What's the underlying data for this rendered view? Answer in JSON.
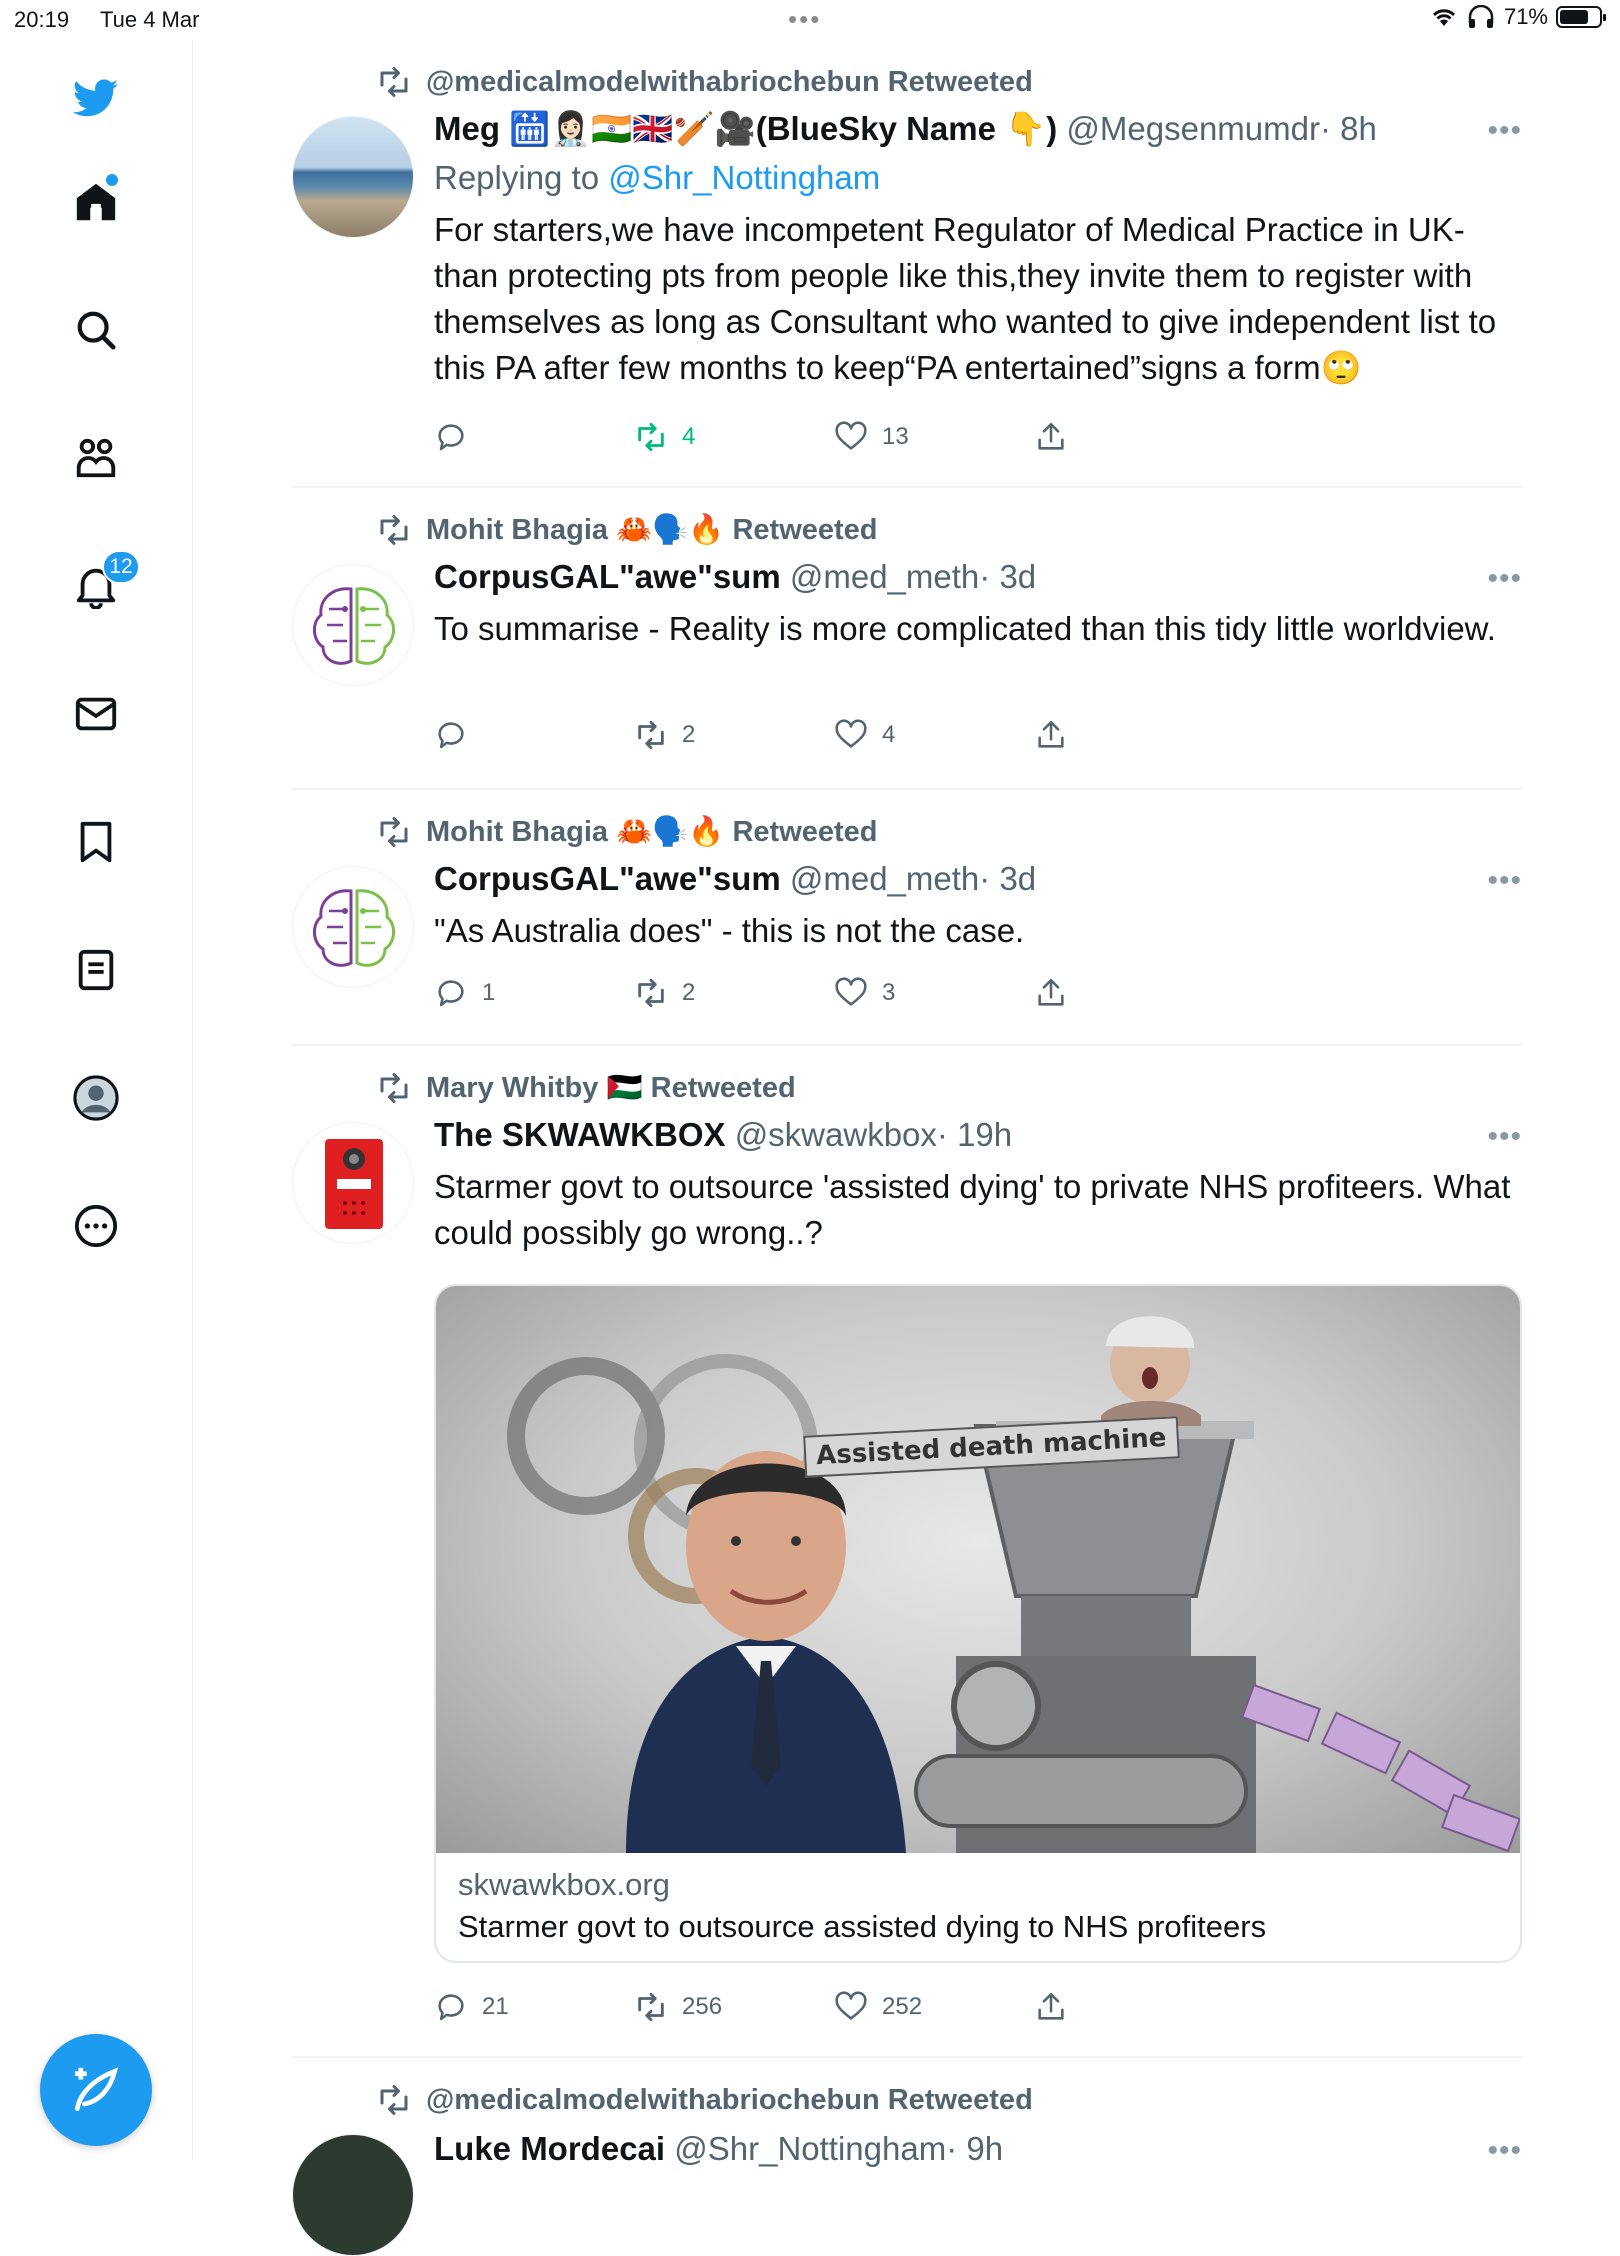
{
  "status_bar": {
    "time": "20:19",
    "date": "Tue 4 Mar",
    "battery": "71%"
  },
  "sidebar": {
    "notifications_badge": "12"
  },
  "tweets": [
    {
      "retweeted_by": "@medicalmodelwithabriochebun Retweeted",
      "name": "Meg 🛗👩🏻‍⚕️🇮🇳🇬🇧🏏🎥(BlueSky Name 👇)",
      "handle": "@Megsenmumdr",
      "time": "· 8h",
      "replying_label": "Replying to",
      "replying_to": "@Shr_Nottingham",
      "text": "For starters,we have incompetent Regulator of Medical Practice in UK- than protecting pts from people like this,they invite them to register with themselves as long as Consultant who wanted to give independent list to this PA after few months to keep“PA entertained”signs a form🙄",
      "replies": "",
      "retweets": "4",
      "likes": "13"
    },
    {
      "retweeted_by": "Mohit Bhagia 🦀🗣️🔥 Retweeted",
      "name": "CorpusGAL\"awe\"sum",
      "handle": "@med_meth",
      "time": "· 3d",
      "text": "To summarise - Reality is more complicated than this tidy little worldview.",
      "replies": "",
      "retweets": "2",
      "likes": "4"
    },
    {
      "retweeted_by": "Mohit Bhagia 🦀🗣️🔥 Retweeted",
      "name": "CorpusGAL\"awe\"sum",
      "handle": "@med_meth",
      "time": "· 3d",
      "text": "\"As Australia does\" - this is not the case.",
      "replies": "1",
      "retweets": "2",
      "likes": "3"
    },
    {
      "retweeted_by": "Mary Whitby 🇵🇸 Retweeted",
      "name": "The SKWAWKBOX",
      "handle": "@skwawkbox",
      "time": "· 19h",
      "text": "Starmer govt to outsource 'assisted dying' to private NHS profiteers. What could possibly go wrong..?",
      "card_image_text": "Assisted death machine",
      "card_domain": "skwawkbox.org",
      "card_title": "Starmer govt to outsource assisted dying to NHS profiteers",
      "replies": "21",
      "retweets": "256",
      "likes": "252"
    },
    {
      "retweeted_by": "@medicalmodelwithabriochebun Retweeted",
      "name": "Luke Mordecai",
      "handle": "@Shr_Nottingham",
      "time": "· 9h"
    }
  ],
  "colors": {
    "accent": "#1d9bf0",
    "retweet_green": "#00ba7c",
    "secondary_text": "#536471"
  },
  "icons": [
    "twitter-logo-icon",
    "home-icon",
    "search-icon",
    "communities-icon",
    "bell-icon",
    "mail-icon",
    "bookmark-icon",
    "lists-icon",
    "profile-icon",
    "more-icon",
    "retweet-icon",
    "reply-icon",
    "like-icon",
    "share-icon",
    "compose-icon"
  ]
}
